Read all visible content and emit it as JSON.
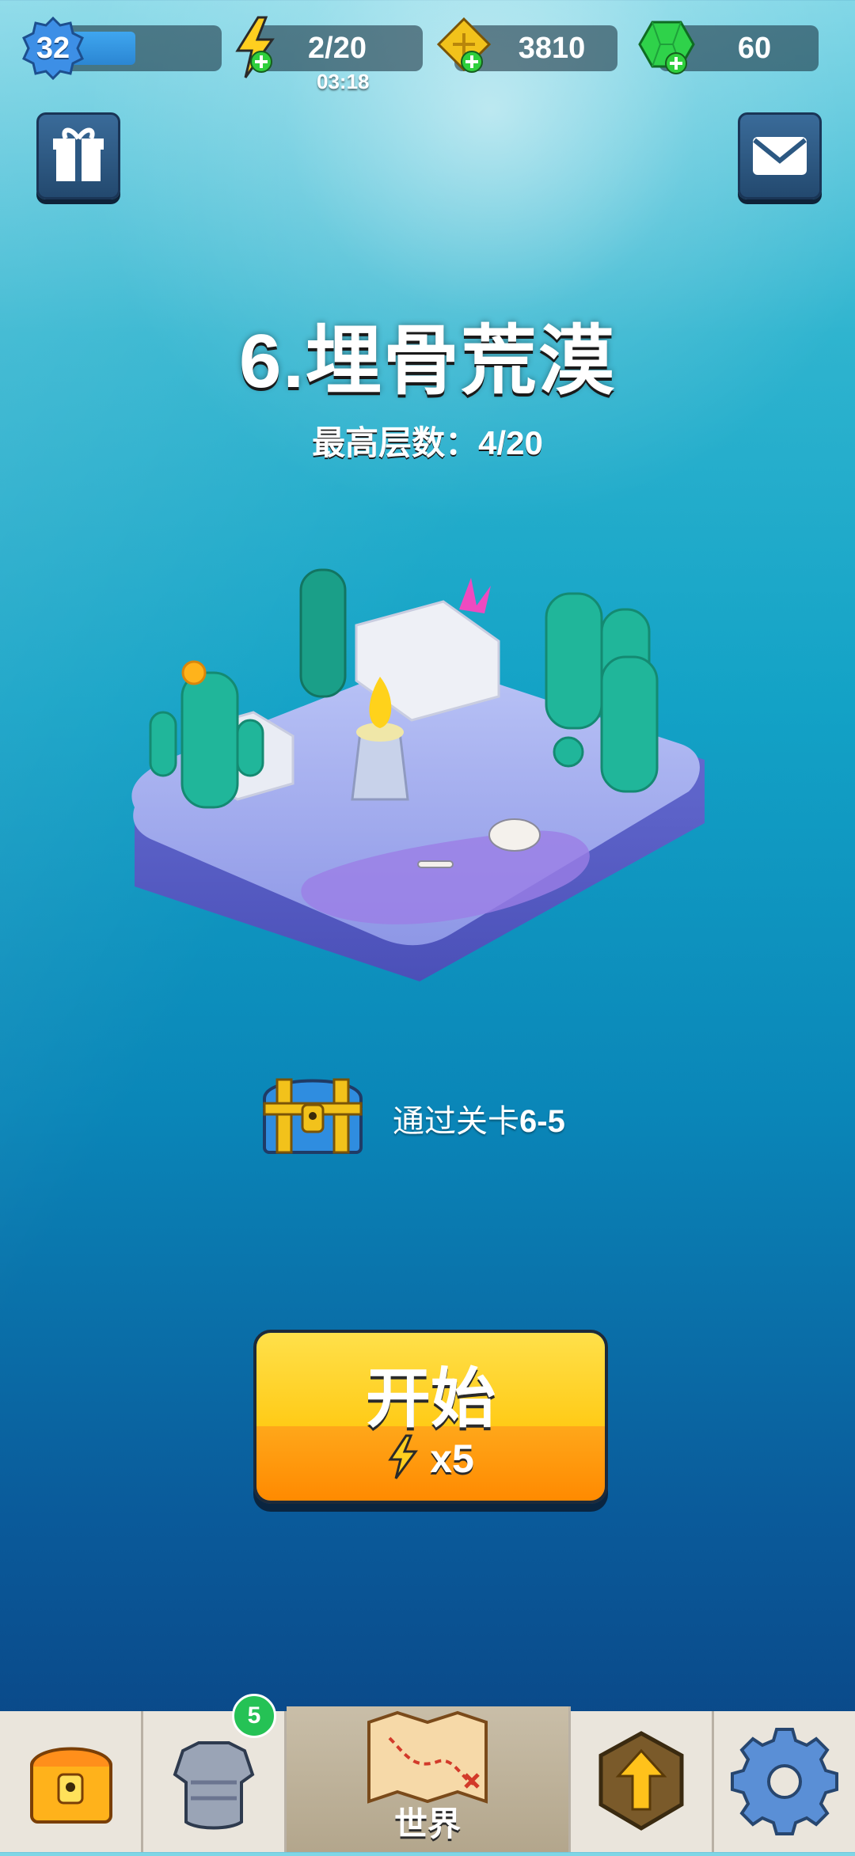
{
  "hud": {
    "level": "32",
    "level_progress": 0.45,
    "energy": "2/20",
    "energy_timer": "03:18",
    "gold": "3810",
    "gems": "60"
  },
  "corner_buttons": {
    "left_icon": "gift-icon",
    "right_icon": "mail-icon"
  },
  "stage": {
    "title": "6.埋骨荒漠",
    "best_floor": "最高层数：4/20"
  },
  "reward": {
    "text_prefix": "通过关卡",
    "text_stage": "6-5",
    "icon": "treasure-chest-icon"
  },
  "start_button": {
    "label": "开始",
    "cost": "x5",
    "cost_icon": "lightning-icon"
  },
  "nav": {
    "items": [
      {
        "name": "shop",
        "icon": "chest-icon",
        "label": ""
      },
      {
        "name": "equipment",
        "icon": "armor-icon",
        "label": "",
        "badge": "5"
      },
      {
        "name": "world",
        "icon": "map-icon",
        "label": "世界",
        "active": true
      },
      {
        "name": "talent",
        "icon": "upgrade-arrow-icon",
        "label": ""
      },
      {
        "name": "settings",
        "icon": "gear-icon",
        "label": ""
      }
    ]
  },
  "colors": {
    "accent_yellow": "#ffcb17",
    "accent_orange": "#ff8a00",
    "ocean_top": "#2fb4cf",
    "ocean_bottom": "#0b3f7f",
    "gem_green": "#25c255"
  }
}
